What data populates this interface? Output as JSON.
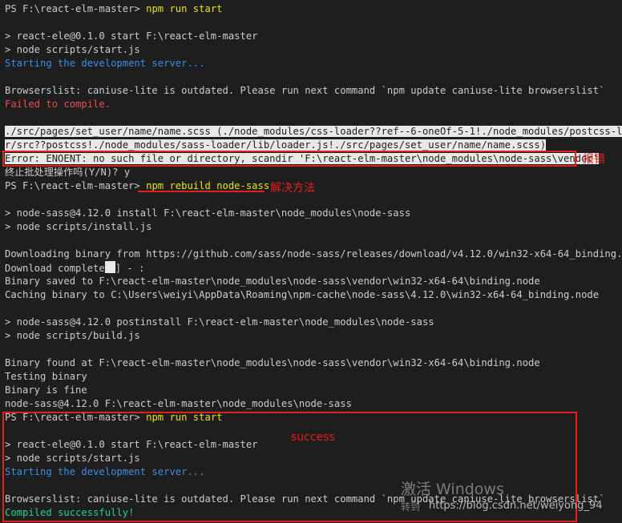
{
  "terminal": {
    "line1_prompt": "PS F:\\react-elm-master>",
    "line1_cmd": "npm run start",
    "line3": "> react-ele@0.1.0 start F:\\react-elm-master",
    "line4": "> node scripts/start.js",
    "line5": "Starting the development server...",
    "line7": "Browserslist: caniuse-lite is outdated. Please run next command `npm update caniuse-lite browserslist`",
    "line8": "Failed to compile.",
    "line10": "./src/pages/set_user/name/name.scss (./node_modules/css-loader??ref--6-oneOf-5-1!./node_modules/postcss-loade",
    "line11": "r/src??postcss!./node_modules/sass-loader/lib/loader.js!./src/pages/set_user/name/name.scss)",
    "line12": "Error: ENOENT: no such file or directory, scandir 'F:\\react-elm-master\\node_modules\\node-sass\\vendor'",
    "line13": "终止批处理操作吗(Y/N)? y",
    "line14_prompt": "PS F:\\react-elm-master>",
    "line14_cmd": "npm rebuild node-sass",
    "line16": "> node-sass@4.12.0 install F:\\react-elm-master\\node_modules\\node-sass",
    "line17": "> node scripts/install.js",
    "line19": "Downloading binary from https://github.com/sass/node-sass/releases/download/v4.12.0/win32-x64-64_binding.node",
    "line20a": "Download complete",
    "line20b": "] - :",
    "line21": "Binary saved to F:\\react-elm-master\\node_modules\\node-sass\\vendor\\win32-x64-64\\binding.node",
    "line22": "Caching binary to C:\\Users\\weiyi\\AppData\\Roaming\\npm-cache\\node-sass\\4.12.0\\win32-x64-64_binding.node",
    "line24": "> node-sass@4.12.0 postinstall F:\\react-elm-master\\node_modules\\node-sass",
    "line25": "> node scripts/build.js",
    "line27": "Binary found at F:\\react-elm-master\\node_modules\\node-sass\\vendor\\win32-x64-64\\binding.node",
    "line28": "Testing binary",
    "line29": "Binary is fine",
    "line30": "node-sass@4.12.0 F:\\react-elm-master\\node_modules\\node-sass",
    "line31_prompt": "PS F:\\react-elm-master>",
    "line31_cmd": "npm run start",
    "line33": "> react-ele@0.1.0 start F:\\react-elm-master",
    "line34": "> node scripts/start.js",
    "line35": "Starting the development server...",
    "line37": "Browserslist: caniuse-lite is outdated. Please run next command `npm update caniuse-lite browserslist`",
    "line38": "Compiled successfully!"
  },
  "annotations": {
    "error_label": "报错",
    "fix_label": "解决方法",
    "success_label": "success"
  },
  "watermark": {
    "activate": "激活 Windows",
    "goto": "转到",
    "csdn": "https://blog.csdn.net/weiyong_94"
  },
  "colors": {
    "background": "#1e1e1e",
    "text": "#cccccc",
    "command": "#e5e510",
    "info": "#3b8eea",
    "error": "#f14c4c",
    "success": "#23d18b",
    "annotation": "#e3201c"
  }
}
